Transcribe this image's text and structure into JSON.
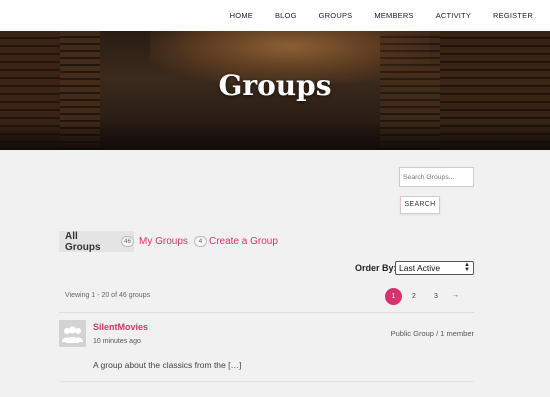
{
  "nav": {
    "items": [
      "HOME",
      "BLOG",
      "GROUPS",
      "MEMBERS",
      "ACTIVITY",
      "REGISTER"
    ]
  },
  "hero": {
    "title": "Groups"
  },
  "search": {
    "placeholder": "Search Groups...",
    "button_label": "SEARCH"
  },
  "tabs": {
    "all": {
      "label": "All Groups",
      "count": "46"
    },
    "my": {
      "label": "My Groups",
      "count": "4"
    },
    "create": {
      "label": "Create a Group"
    }
  },
  "order_by": {
    "label": "Order By:",
    "selected": "Last Active"
  },
  "pagination": {
    "viewing_text": "Viewing 1 - 20 of 46 groups",
    "current": "1",
    "pages": [
      "2",
      "3"
    ],
    "next": "→"
  },
  "groups": [
    {
      "name": "SilentMovies",
      "time": "10 minutes ago",
      "meta": "Public Group / 1 member",
      "description": "A group about the classics from the […]"
    }
  ],
  "colors": {
    "accent": "#d6336c"
  }
}
